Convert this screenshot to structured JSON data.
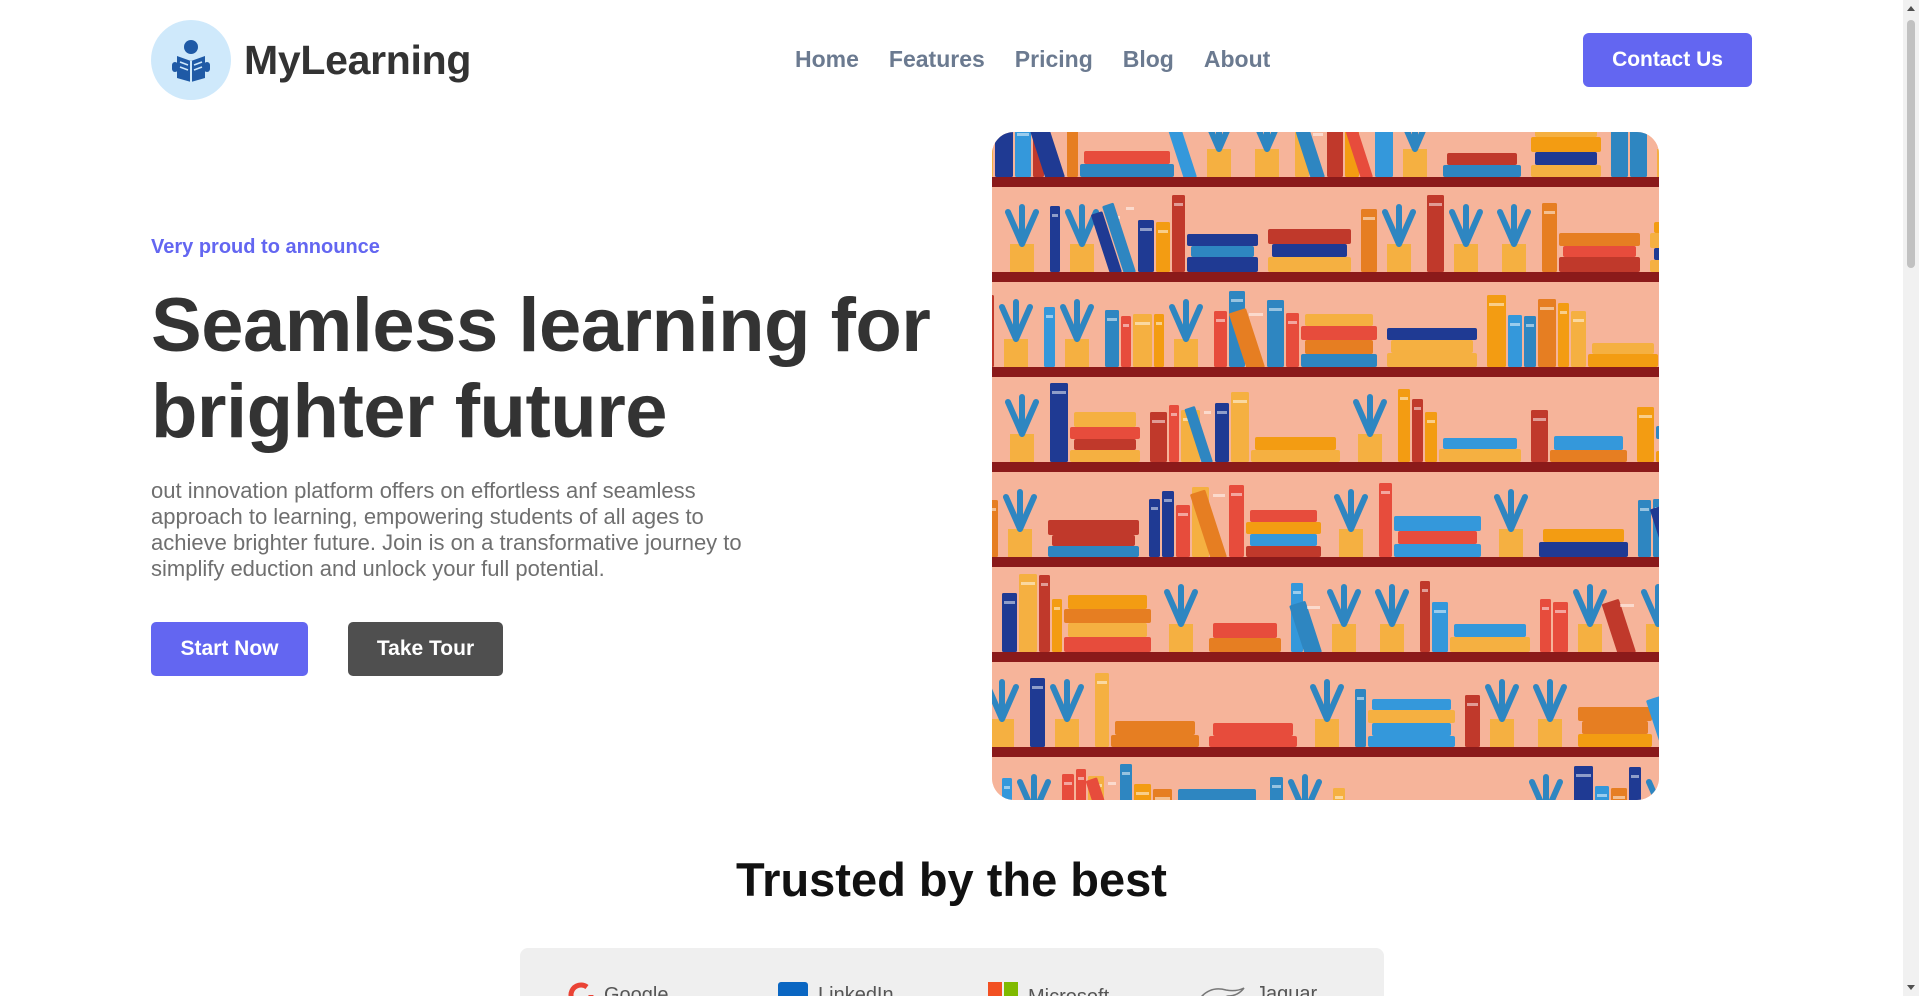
{
  "header": {
    "brand": "MyLearning",
    "logo_icon": "reading-book-icon",
    "nav": [
      {
        "label": "Home"
      },
      {
        "label": "Features"
      },
      {
        "label": "Pricing"
      },
      {
        "label": "Blog"
      },
      {
        "label": "About"
      }
    ],
    "contact_label": "Contact Us"
  },
  "hero": {
    "announcement": "Very proud to announce",
    "headline": "Seamless learning for brighter future",
    "description": "out innovation platform offers on effortless anf seamless approach to learning, empowering students of all ages to achieve brighter future. Join is on a transformative journey to simplify eduction and unlock your full potential.",
    "start_label": "Start Now",
    "tour_label": "Take Tour",
    "image_alt": "bookshelf-illustration"
  },
  "trusted": {
    "title": "Trusted by the best",
    "partners": [
      {
        "name": "Google",
        "icon": "google-logo-icon"
      },
      {
        "name": "LinkedIn",
        "icon": "linkedin-logo-icon"
      },
      {
        "name": "Microsoft",
        "icon": "microsoft-logo-icon"
      },
      {
        "name": "Jaguar",
        "icon": "jaguar-logo-icon"
      }
    ]
  },
  "colors": {
    "accent": "#6366f1",
    "dark_button": "#4f4f4f",
    "logo_bg": "#cfe9fb",
    "nav_text": "#6b7a90",
    "shelf_bg": "#f6b49a",
    "shelf_board": "#8b1a1a"
  }
}
